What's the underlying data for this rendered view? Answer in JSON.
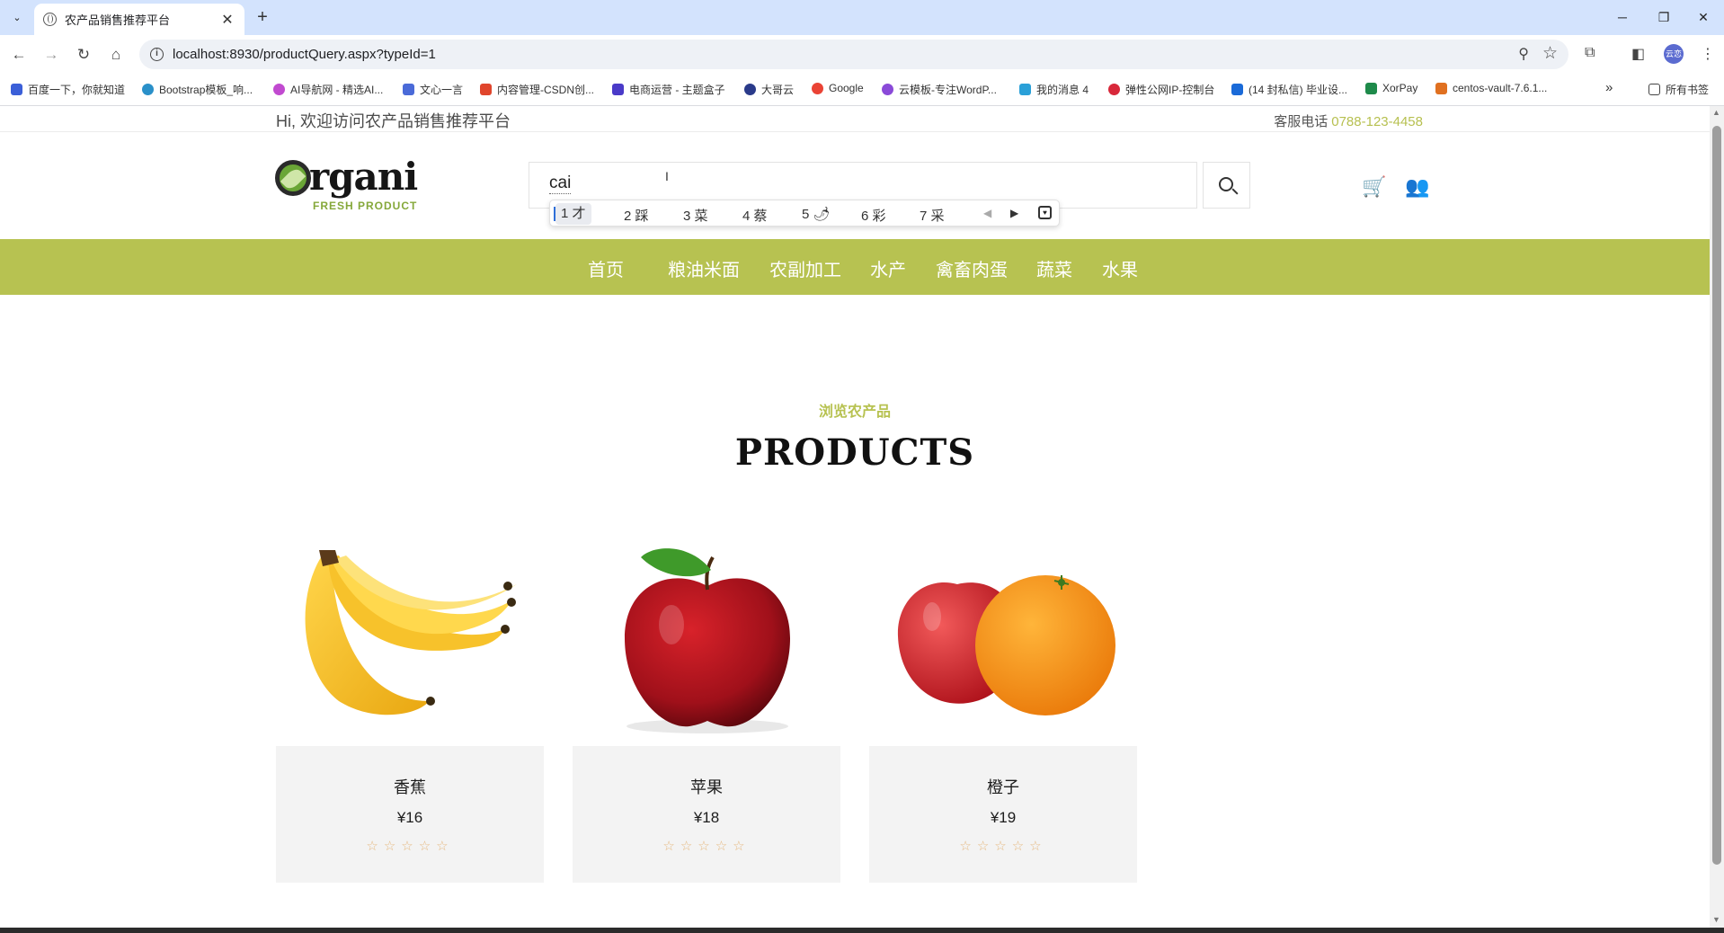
{
  "browser": {
    "tab_title": "农产品销售推荐平台",
    "tab_close": "✕",
    "new_tab": "+",
    "url": "localhost:8930/productQuery.aspx?typeId=1",
    "window_controls": {
      "minimize": "─",
      "maximize": "❐",
      "close": "✕"
    },
    "profile_initials": "云恋"
  },
  "bookmarks": [
    {
      "label": "百度一下，你就知道",
      "color": "#3b5fd8"
    },
    {
      "label": "Bootstrap模板_响...",
      "color": "#2a90c9"
    },
    {
      "label": "AI导航网 - 精选AI...",
      "color": "#c14ad0"
    },
    {
      "label": "文心一言",
      "color": "#4a6ad8"
    },
    {
      "label": "内容管理-CSDN创...",
      "color": "#e0452c"
    },
    {
      "label": "电商运营 - 主题盒子",
      "color": "#4a3ac8"
    },
    {
      "label": "大哥云",
      "color": "#2a3a8a"
    },
    {
      "label": "Google",
      "color": "#ea4335"
    },
    {
      "label": "云模板-专注WordP...",
      "color": "#8a4ad8"
    },
    {
      "label": "我的消息 4",
      "color": "#2aa0d8"
    },
    {
      "label": "弹性公网IP-控制台",
      "color": "#d8283a"
    },
    {
      "label": "(14 封私信) 毕业设...",
      "color": "#1a6ad8"
    },
    {
      "label": "XorPay",
      "color": "#1e8a4a"
    },
    {
      "label": "centos-vault-7.6.1...",
      "color": "#e07020"
    }
  ],
  "bookmarks_more": "»",
  "bookmarks_folder": "所有书签",
  "topbar": {
    "welcome": "Hi, 欢迎访问农产品销售推荐平台",
    "hotline_label": "客服电话",
    "hotline_number": "0788-123-4458"
  },
  "logo": {
    "word": "rgani",
    "tagline": "FRESH PRODUCT"
  },
  "search": {
    "value": "cai"
  },
  "ime": {
    "candidates": [
      "1 才",
      "2 踩",
      "3 菜",
      "4 蔡",
      "5 🌶",
      "6 彩",
      "7 采"
    ],
    "prev": "◀",
    "next": "▶"
  },
  "nav": [
    "首页",
    "粮油米面",
    "农副加工",
    "水产",
    "禽畜肉蛋",
    "蔬菜",
    "水果"
  ],
  "section": {
    "subtitle": "浏览农产品",
    "title": "PRODUCTS"
  },
  "products": [
    {
      "name": "香蕉",
      "price": "¥16",
      "stars": "☆☆☆☆☆",
      "rating": 0
    },
    {
      "name": "苹果",
      "price": "¥18",
      "stars": "☆☆☆☆☆",
      "rating": 0
    },
    {
      "name": "橙子",
      "price": "¥19",
      "stars": "☆☆☆☆☆",
      "rating": 0
    }
  ],
  "colors": {
    "accent": "#b7c251",
    "nav_bg": "#b7c251",
    "star": "#e6b981",
    "phone": "#b7c050"
  }
}
